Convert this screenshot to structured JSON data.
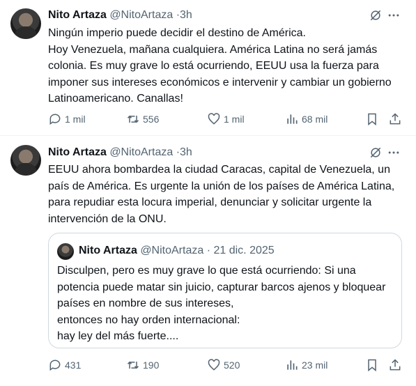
{
  "tweets": [
    {
      "name": "Nito Artaza",
      "handle": "@NitoArtaza",
      "separator": "·",
      "time": "3h",
      "text": "Ningún imperio puede decidir el destino de América.\nHoy Venezuela, mañana cualquiera. América Latina no será jamás colonia. Es muy grave lo está ocurriendo, EEUU usa la fuerza para imponer sus intereses económicos e intervenir y cambiar un gobierno Latinoamericano. Canallas!",
      "replies": "1 mil",
      "reposts": "556",
      "likes": "1 mil",
      "views": "68 mil"
    },
    {
      "name": "Nito Artaza",
      "handle": "@NitoArtaza",
      "separator": "·",
      "time": "3h",
      "text": "EEUU ahora bombardea la ciudad Caracas, capital de Venezuela, un país de América. Es urgente la unión de los países de América Latina, para repudiar esta locura imperial, denunciar y solicitar urgente la intervención de la ONU.",
      "quote": {
        "name": "Nito Artaza",
        "handle": "@NitoArtaza",
        "separator": "·",
        "date": "21 dic. 2025",
        "text": "Disculpen, pero es muy grave lo que está ocurriendo: Si una potencia puede matar sin juicio, capturar barcos ajenos y bloquear países en nombre de sus intereses,\nentonces no hay orden internacional:\nhay ley del más fuerte...."
      },
      "replies": "431",
      "reposts": "190",
      "likes": "520",
      "views": "23 mil"
    }
  ],
  "icons": [
    "grok-icon",
    "more-icon",
    "reply-icon",
    "repost-icon",
    "like-icon",
    "views-icon",
    "bookmark-icon",
    "share-icon"
  ],
  "colors": {
    "text": "#0f1419",
    "secondary": "#536471",
    "border": "#cfd9de"
  }
}
